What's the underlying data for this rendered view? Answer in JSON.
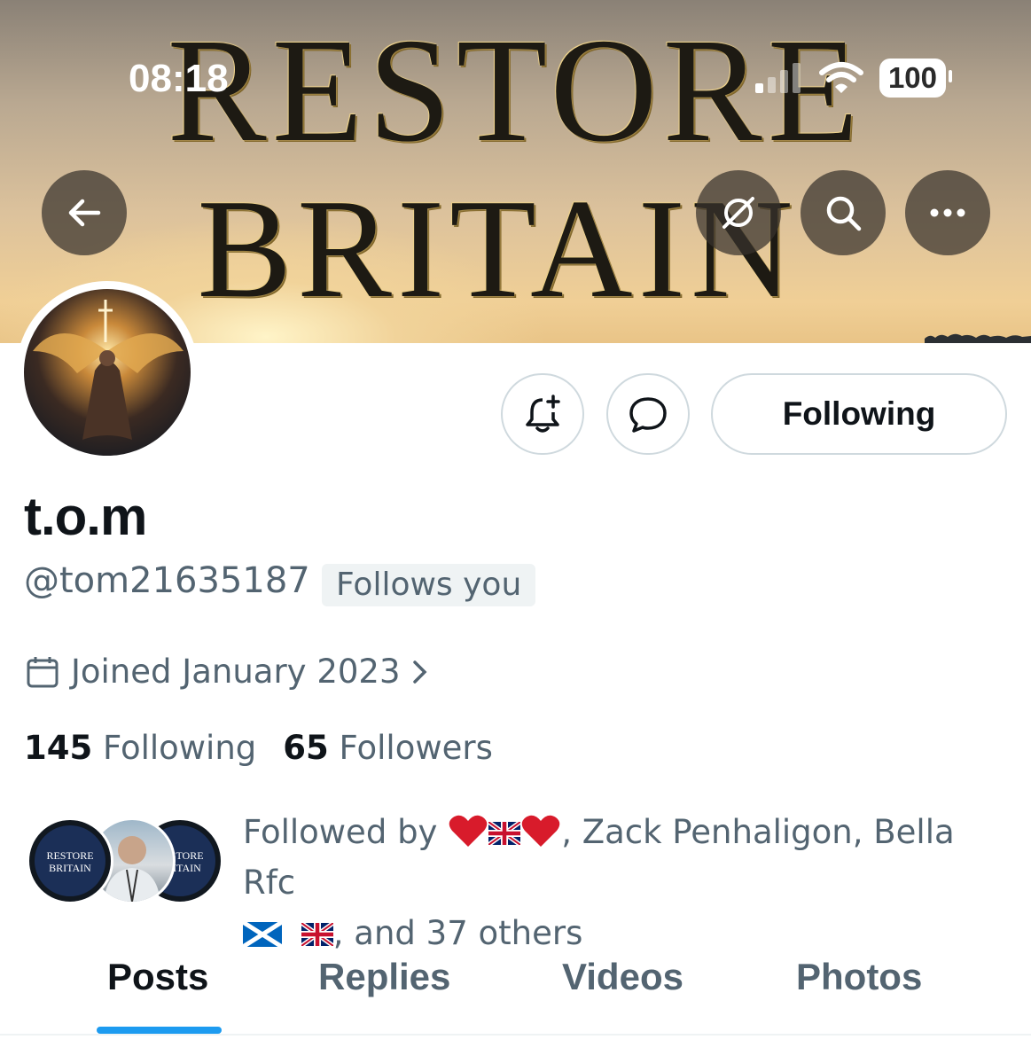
{
  "status_bar": {
    "time": "08:18",
    "battery": "100"
  },
  "banner": {
    "line1": "RESTORE",
    "line2": "BRITAIN"
  },
  "header_actions": {
    "back": "back-arrow-icon",
    "grok": "grok-icon",
    "search": "search-icon",
    "more": "more-icon"
  },
  "profile": {
    "name": "t.o.m",
    "handle": "@tom21635187",
    "follows_you": "Follows you",
    "joined": "Joined January 2023",
    "following_count": "145",
    "following_label": "Following",
    "followers_count": "65",
    "followers_label": "Followers"
  },
  "actions": {
    "following_button": "Following"
  },
  "followed_by": {
    "prefix": "Followed by",
    "names_suffix": ", Zack Penhaligon, Bella Rfc",
    "others": ", and 37 others",
    "badge_text_1": "RESTORE",
    "badge_text_2": "BRITAIN"
  },
  "tabs": [
    "Posts",
    "Replies",
    "Videos",
    "Photos"
  ],
  "colors": {
    "accent": "#1d9bf0",
    "secondary_text": "#536471",
    "primary_text": "#0f1419"
  }
}
